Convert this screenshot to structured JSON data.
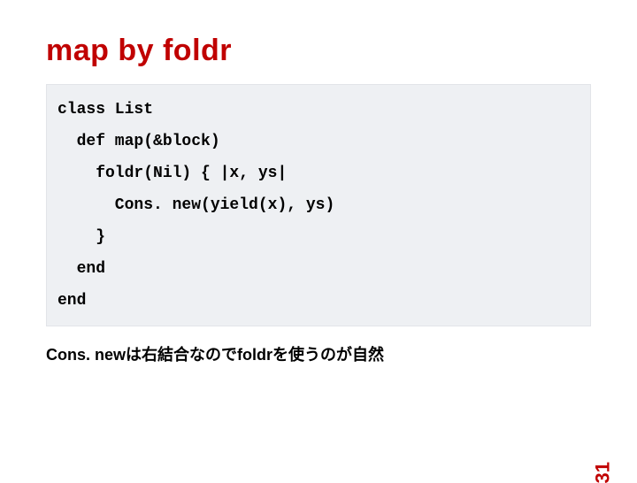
{
  "title": "map by foldr",
  "code": {
    "l1": "class List",
    "l2": "  def map(&block)",
    "l3": "    foldr(Nil) { |x, ys|",
    "l4": "      Cons. new(yield(x), ys)",
    "l5": "    }",
    "l6": "  end",
    "l7": "end"
  },
  "note": "Cons. newは右結合なのでfoldrを使うのが自然",
  "page_number": "31"
}
